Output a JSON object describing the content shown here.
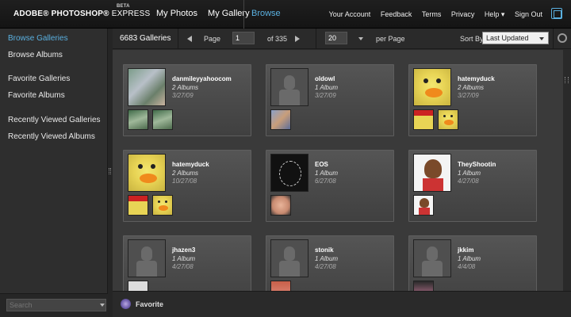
{
  "app": {
    "logo": "ADOBE® PHOTOSHOP®",
    "logo_sub": "EXPRESS",
    "beta": "BETA"
  },
  "nav": {
    "main": [
      "My Photos",
      "My Gallery"
    ],
    "active": "Browse",
    "right": [
      "Your Account",
      "Feedback",
      "Terms",
      "Privacy",
      "Help ▾",
      "Sign Out"
    ]
  },
  "sidebar": {
    "items": [
      {
        "label": "Browse Galleries",
        "active": true
      },
      {
        "label": "Browse Albums",
        "active": false
      },
      {
        "label": "Favorite Galleries",
        "active": false
      },
      {
        "label": "Favorite Albums",
        "active": false
      },
      {
        "label": "Recently Viewed Galleries",
        "active": false
      },
      {
        "label": "Recently Viewed Albums",
        "active": false
      }
    ],
    "search_placeholder": "Search"
  },
  "toolbar": {
    "gallery_count": "6683 Galleries",
    "page_label": "Page",
    "page_value": "1",
    "page_of": "of 335",
    "per_page_value": "20",
    "per_page_label": "per Page",
    "sort_label": "Sort By:",
    "sort_value": "Last Updated"
  },
  "galleries": [
    {
      "name": "danmileyyahoocom",
      "albums": "2 Albums",
      "date": "3/27/09",
      "thumb": "ph-photo-kids",
      "minis": [
        "ph-photo-green",
        "ph-photo-green"
      ]
    },
    {
      "name": "oldowl",
      "albums": "1 Album",
      "date": "3/27/09",
      "thumb": "ph-silhouette",
      "minis": [
        "ph-photo-man"
      ]
    },
    {
      "name": "hatemyduck",
      "albums": "2 Albums",
      "date": "3/27/09",
      "thumb": "ph-duck",
      "minis": [
        "ph-duck-santa",
        "ph-duck"
      ]
    },
    {
      "name": "hatemyduck",
      "albums": "2 Albums",
      "date": "10/27/08",
      "thumb": "ph-duck",
      "minis": [
        "ph-duck-santa",
        "ph-duck"
      ]
    },
    {
      "name": "EOS",
      "albums": "1 Album",
      "date": "6/27/08",
      "thumb": "ph-dark-sketch",
      "minis": [
        "ph-baby"
      ]
    },
    {
      "name": "TheyShootin",
      "albums": "1 Album",
      "date": "4/27/08",
      "thumb": "ph-cartoon",
      "minis": [
        "ph-cartoon"
      ]
    },
    {
      "name": "jhazen3",
      "albums": "1 Album",
      "date": "4/27/08",
      "thumb": "ph-silhouette",
      "minis": [
        "ph-light"
      ]
    },
    {
      "name": "stonik",
      "albums": "1 Album",
      "date": "4/27/08",
      "thumb": "ph-silhouette",
      "minis": [
        "ph-red"
      ]
    },
    {
      "name": "jkkim",
      "albums": "1 Album",
      "date": "4/4/08",
      "thumb": "ph-silhouette",
      "minis": [
        "ph-pink"
      ]
    }
  ],
  "bottom": {
    "favorite_label": "Favorite"
  }
}
